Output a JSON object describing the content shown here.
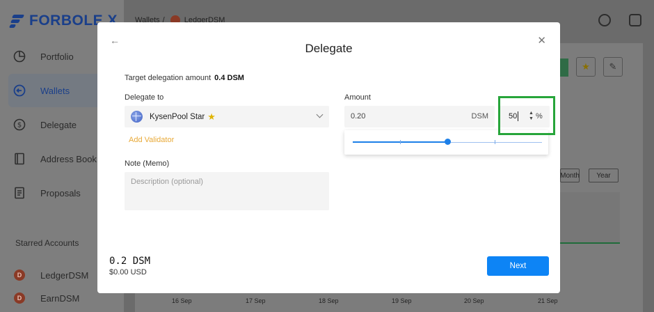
{
  "app": {
    "brand": "FORBOLE X"
  },
  "sidebar": {
    "items": [
      {
        "label": "Portfolio",
        "icon": "pie-chart-icon",
        "active": false
      },
      {
        "label": "Wallets",
        "icon": "wallet-icon",
        "active": true
      },
      {
        "label": "Delegate",
        "icon": "dollar-circle-icon",
        "active": false
      },
      {
        "label": "Address Book",
        "icon": "address-book-icon",
        "active": false
      },
      {
        "label": "Proposals",
        "icon": "document-icon",
        "active": false
      }
    ],
    "starred_title": "Starred Accounts",
    "starred": [
      {
        "label": "LedgerDSM"
      },
      {
        "label": "EarnDSM"
      }
    ]
  },
  "breadcrumb": {
    "root": "Wallets",
    "separator": "/",
    "current": "LedgerDSM"
  },
  "background": {
    "range_buttons": [
      "Month",
      "Year"
    ],
    "x_ticks": [
      "16 Sep",
      "17 Sep",
      "18 Sep",
      "19 Sep",
      "20 Sep",
      "21 Sep"
    ]
  },
  "modal": {
    "title": "Delegate",
    "target_label": "Target delegation amount",
    "target_value": "0.4 DSM",
    "delegate_to_label": "Delegate to",
    "validator_name": "KysenPool Star",
    "add_validator": "Add Validator",
    "note_label": "Note (Memo)",
    "note_placeholder": "Description (optional)",
    "amount_label": "Amount",
    "amount_value": "0.20",
    "amount_unit": "DSM",
    "percent_value": "50",
    "percent_symbol": "%",
    "slider_fraction": 0.5,
    "total_amount": "0.2 DSM",
    "total_usd": "$0.00 USD",
    "next_label": "Next"
  },
  "colors": {
    "accent": "#0d84f5",
    "brand": "#1a3f8a",
    "add_validator": "#e8a937",
    "highlight": "#27a53a"
  }
}
